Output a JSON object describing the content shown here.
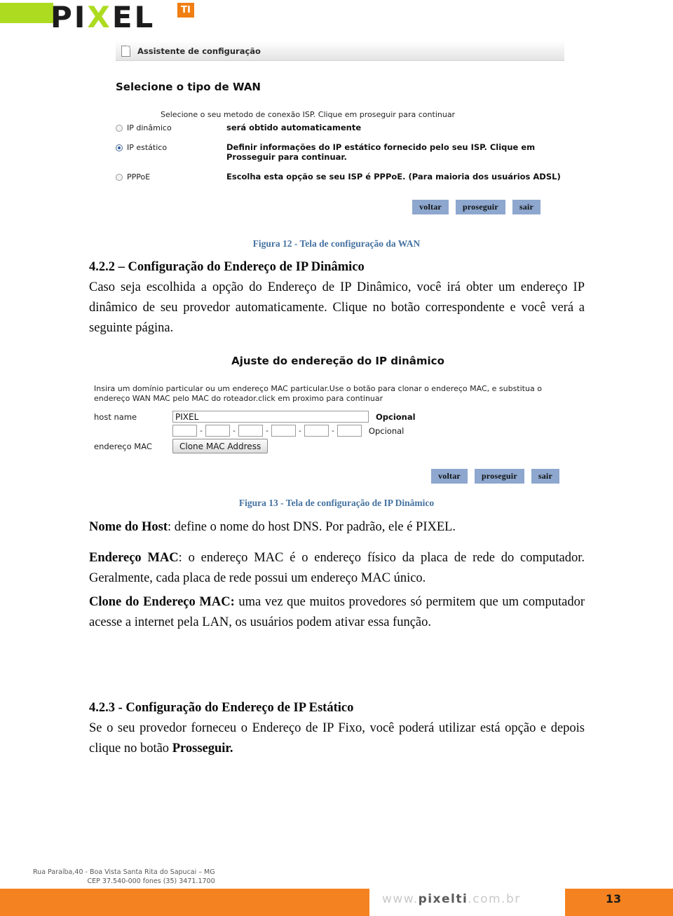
{
  "brand": {
    "logo_text_pix": "PI",
    "logo_text_x": "X",
    "logo_text_el": "EL",
    "logo_badge": "TI",
    "green": "#addb20",
    "orange": "#f58220",
    "logo_orange": "#f07e12"
  },
  "figure_wan": {
    "titlebar": "Assistente de configuração",
    "heading": "Selecione o tipo de WAN",
    "hint": "Selecione o seu metodo de conexão ISP. Clique em proseguir para continuar",
    "options": [
      {
        "label": "IP dinâmico",
        "description": "será obtido automaticamente",
        "selected": false
      },
      {
        "label": "IP estático",
        "description": "Definir informações do IP estático fornecido pelo seu ISP. Clique em Prosseguir para continuar.",
        "selected": true
      },
      {
        "label": "PPPoE",
        "description": "Escolha esta opção se seu ISP é PPPoE. (Para maioria dos usuários ADSL)",
        "selected": false
      }
    ],
    "buttons": [
      "voltar",
      "proseguir",
      "sair"
    ]
  },
  "caption_12": "Figura 12 - Tela de configuração da WAN",
  "section_422": {
    "title": "4.2.2 – Configuração do Endereço de IP Dinâmico",
    "body": "Caso seja escolhida a opção do Endereço de IP Dinâmico, você irá obter um endereço IP dinâmico de seu provedor automaticamente. Clique no botão correspondente e você verá a seguinte página."
  },
  "figure_dynamic_ip": {
    "heading": "Ajuste do endereção do IP dinâmico",
    "hint": "Insira um domínio particular ou um endereço MAC particular.Use o botão para clonar o endereço MAC, e substitua o endereço WAN MAC pelo MAC do roteador.click em proximo para continuar",
    "host_label": "host name",
    "host_value": "PIXEL",
    "host_optional": "Opcional",
    "mac_label": "endereço MAC",
    "mac_segments": [
      "",
      "",
      "",
      "",
      "",
      ""
    ],
    "mac_separator": "-",
    "mac_optional": "Opcional",
    "clone_button": "Clone MAC Address",
    "buttons": [
      "voltar",
      "proseguir",
      "sair"
    ]
  },
  "caption_13": "Figura 13 - Tela de configuração de IP Dinâmico",
  "definitions": {
    "host": {
      "term": "Nome do Host",
      "text": ": define o nome do host DNS. Por padrão, ele é PIXEL."
    },
    "mac": {
      "term": "Endereço MAC",
      "text": ": o endereço MAC é o endereço físico da placa de rede do computador. Geralmente, cada placa de rede possui um endereço MAC único."
    },
    "clone": {
      "term": "Clone do Endereço MAC:",
      "text": " uma vez que muitos provedores só permitem que um computador acesse a internet pela LAN, os usuários podem ativar essa função."
    }
  },
  "section_423": {
    "title": "4.2.3 - Configuração do Endereço de IP Estático",
    "body_part1": "Se o seu provedor forneceu o Endereço de IP Fixo, você poderá utilizar está opção e depois clique no botão ",
    "body_bold": "Prosseguir."
  },
  "footer": {
    "address_line1": "Rua Paraíba,40 - Boa Vista Santa Rita do Sapucai – MG",
    "address_line2": "CEP 37.540-000  fones (35) 3471.1700",
    "url_prefix": "www.",
    "url_brand": "pixelti",
    "url_suffix": ".com.br",
    "page_number": "13"
  }
}
